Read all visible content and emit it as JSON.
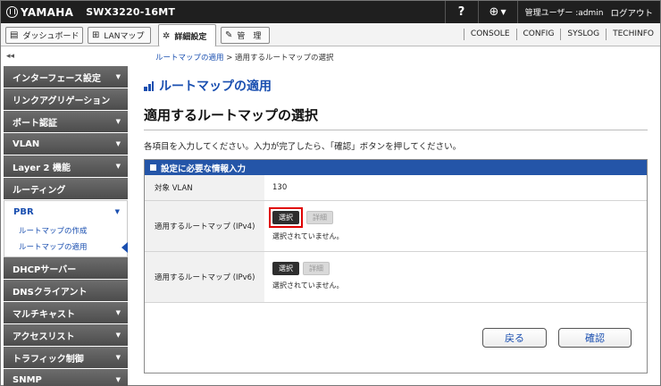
{
  "topbar": {
    "brand": "YAMAHA",
    "model": "SWX3220-16MT",
    "help": "?",
    "language_icon": "globe-icon",
    "user_label": "管理ユーザー :admin",
    "logout": "ログアウト"
  },
  "toolbar": {
    "tabs": [
      {
        "label": "ダッシュボード",
        "icon": "dashboard-icon"
      },
      {
        "label": "LANマップ",
        "icon": "lanmap-icon"
      },
      {
        "label": "詳細設定",
        "icon": "gear-icon"
      },
      {
        "label": "管　理",
        "icon": "wrench-icon"
      }
    ],
    "links": [
      "CONSOLE",
      "CONFIG",
      "SYSLOG",
      "TECHINFO"
    ]
  },
  "collapse_label": "◂◂",
  "breadcrumb": {
    "parent": "ルートマップの適用",
    "separator": " > ",
    "current": "適用するルートマップの選択"
  },
  "sidebar": {
    "items": [
      {
        "label": "インターフェース設定",
        "arrow": "▼"
      },
      {
        "label": "リンクアグリゲーション",
        "arrow": ""
      },
      {
        "label": "ポート認証",
        "arrow": "▼"
      },
      {
        "label": "VLAN",
        "arrow": "▼"
      },
      {
        "label": "Layer 2 機能",
        "arrow": "▼"
      },
      {
        "label": "ルーティング",
        "arrow": ""
      },
      {
        "label": "PBR",
        "arrow": "▼"
      },
      {
        "label": "DHCPサーバー",
        "arrow": ""
      },
      {
        "label": "DNSクライアント",
        "arrow": ""
      },
      {
        "label": "マルチキャスト",
        "arrow": "▼"
      },
      {
        "label": "アクセスリスト",
        "arrow": "▼"
      },
      {
        "label": "トラフィック制御",
        "arrow": "▼"
      },
      {
        "label": "SNMP",
        "arrow": "▼"
      }
    ],
    "pbr_sub": [
      "ルートマップの作成",
      "ルートマップの適用"
    ]
  },
  "main": {
    "title": "ルートマップの適用",
    "subtitle": "適用するルートマップの選択",
    "instruction": "各項目を入力してください。入力が完了したら、「確認」ボタンを押してください。"
  },
  "panel": {
    "header": "設定に必要な情報入力",
    "rows": [
      {
        "label": "対象 VLAN",
        "value": "130"
      },
      {
        "label": "適用するルートマップ (IPv4)",
        "select": "選択",
        "detail": "詳細",
        "status": "選択されていません。"
      },
      {
        "label": "適用するルートマップ (IPv6)",
        "select": "選択",
        "detail": "詳細",
        "status": "選択されていません。"
      }
    ],
    "back": "戻る",
    "confirm": "確認"
  },
  "colors": {
    "accent_blue": "#1a4fb0",
    "panel_header": "#2455a8",
    "highlight_red": "#e00000"
  }
}
